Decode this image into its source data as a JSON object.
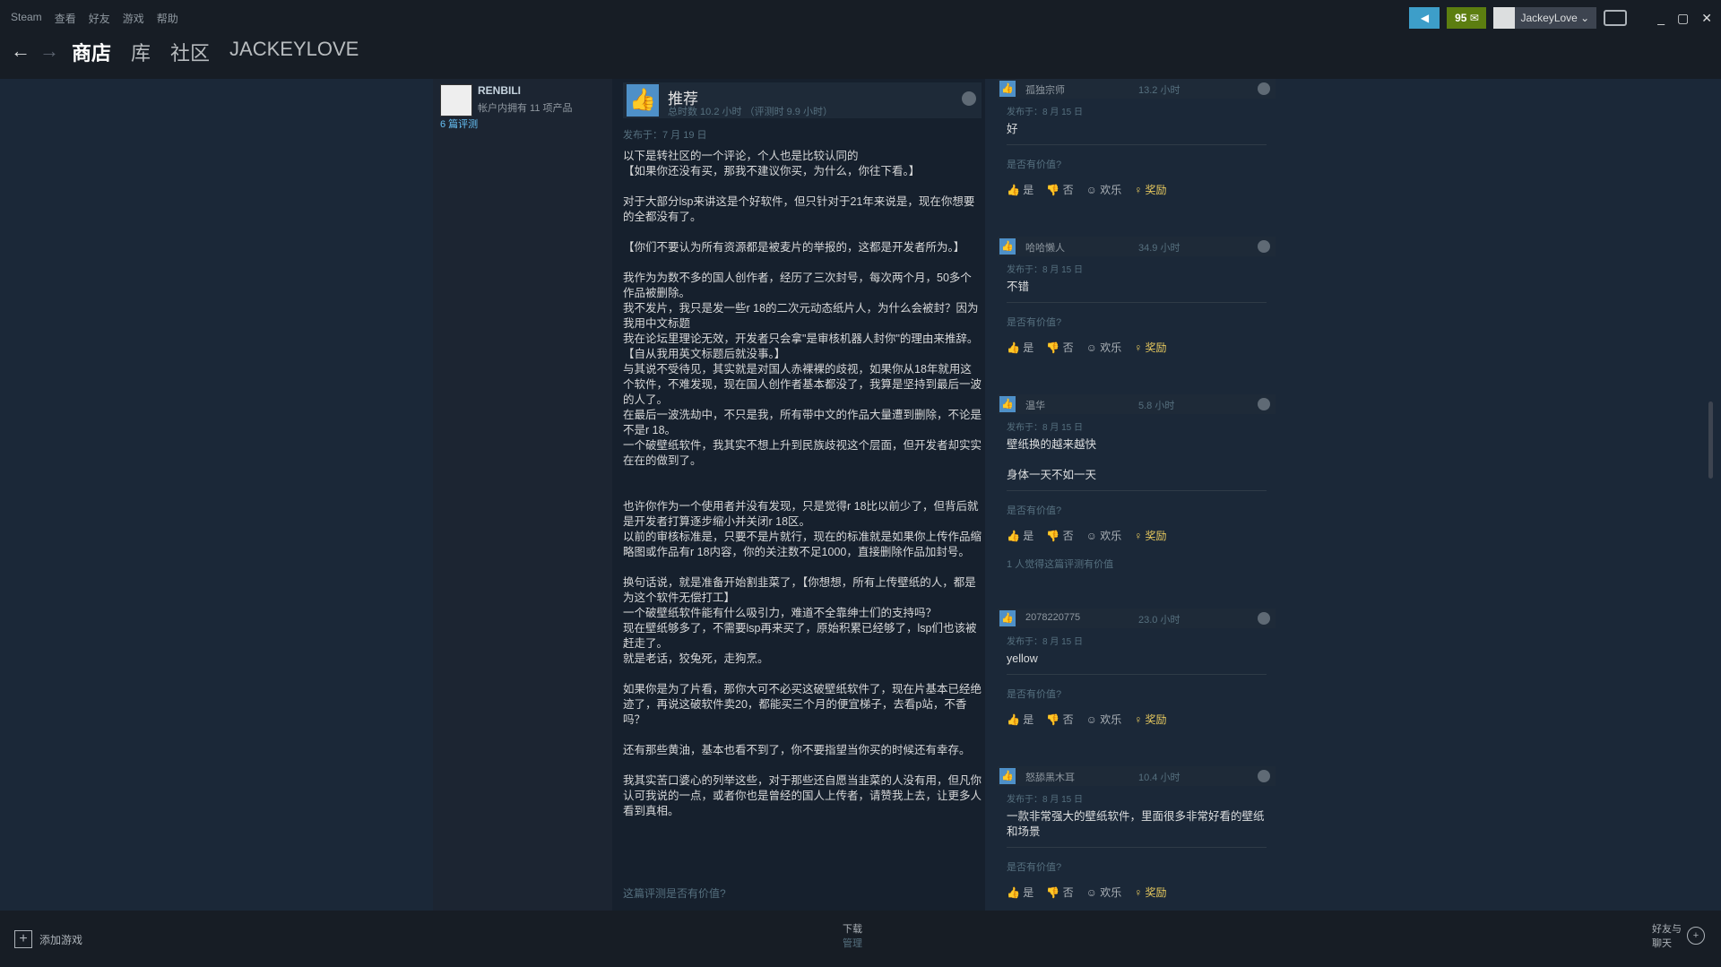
{
  "menu": [
    "Steam",
    "查看",
    "好友",
    "游戏",
    "帮助"
  ],
  "nav": {
    "store": "商店",
    "library": "库",
    "community": "社区",
    "username": "JACKEYLOVE"
  },
  "topright": {
    "notifications": "95 ✉",
    "account": "JackeyLove ⌄",
    "announce_icon": "◀"
  },
  "window_controls": [
    "_",
    "▢",
    "✕"
  ],
  "author": {
    "name": "RENBILI",
    "owned": "帐户内拥有 11 项产品",
    "reviews": "6 篇评测"
  },
  "review": {
    "verdict": "推荐",
    "hours": "总时数 10.2 小时 （评测时 9.9 小时）",
    "posted": "发布于：7 月 19 日",
    "body": "以下是转社区的一个评论，个人也是比较认同的\n【如果你还没有买，那我不建议你买，为什么，你往下看。】\n\n对于大部分lsp来讲这是个好软件，但只针对于21年来说是，现在你想要的全都没有了。\n\n【你们不要认为所有资源都是被麦片的举报的，这都是开发者所为。】\n\n我作为为数不多的国人创作者，经历了三次封号，每次两个月，50多个作品被删除。\n我不发片，我只是发一些r 18的二次元动态纸片人，为什么会被封？因为我用中文标题\n我在论坛里理论无效，开发者只会拿\"是审核机器人封你\"的理由来推辞。【自从我用英文标题后就没事。】\n与其说不受待见，其实就是对国人赤裸裸的歧视，如果你从18年就用这个软件，不难发现，现在国人创作者基本都没了，我算是坚持到最后一波的人了。\n在最后一波洗劫中，不只是我，所有带中文的作品大量遭到删除，不论是不是r 18。\n一个破壁纸软件，我其实不想上升到民族歧视这个层面，但开发者却实实在在的做到了。\n\n\n也许你作为一个使用者并没有发现，只是觉得r 18比以前少了，但背后就是开发者打算逐步缩小并关闭r 18区。\n以前的审核标准是，只要不是片就行，现在的标准就是如果你上传作品缩略图或作品有r 18内容，你的关注数不足1000，直接删除作品加封号。\n\n换句话说，就是准备开始割韭菜了，【你想想，所有上传壁纸的人，都是为这个软件无偿打工】\n一个破壁纸软件能有什么吸引力，难道不全靠绅士们的支持吗？\n现在壁纸够多了，不需要lsp再来买了，原始积累已经够了，lsp们也该被赶走了。\n就是老话，狡兔死，走狗烹。\n\n如果你是为了片看，那你大可不必买这破壁纸软件了，现在片基本已经绝迹了，再说这破软件卖20，都能买三个月的便宜梯子，去看p站，不香吗？\n\n还有那些黄油，基本也看不到了，你不要指望当你买的时候还有幸存。\n\n我其实苦口婆心的列举这些，对于那些还自愿当韭菜的人没有用，但凡你认可我说的一点，或者你也是曾经的国人上传者，请赞我上去，让更多人看到真相。",
    "helpful_question": "这篇评测是否有价值?"
  },
  "vote_labels": {
    "yes": "是",
    "no": "否",
    "funny": "欢乐",
    "award": "奖励",
    "question": "是否有价值?"
  },
  "comments": [
    {
      "name": "孤独宗师",
      "hours": "13.2 小时",
      "date": "发布于：8 月 15 日",
      "text": "好",
      "found": ""
    },
    {
      "name": "哈哈懒人",
      "hours": "34.9 小时",
      "date": "发布于：8 月 15 日",
      "text": "不错",
      "found": ""
    },
    {
      "name": "温华",
      "hours": "5.8 小时",
      "date": "发布于：8 月 15 日",
      "text": "壁纸换的越来越快\n\n身体一天不如一天",
      "found": "1 人觉得这篇评测有价值"
    },
    {
      "name": "2078220775",
      "hours": "23.0 小时",
      "date": "发布于：8 月 15 日",
      "text": "yellow",
      "found": ""
    },
    {
      "name": "怒舔黑木耳",
      "hours": "10.4 小时",
      "date": "发布于：8 月 15 日",
      "text": "一款非常强大的壁纸软件，里面很多非常好看的壁纸和场景",
      "found": ""
    }
  ],
  "bottom": {
    "add_game": "添加游戏",
    "downloads": "下载",
    "downloads_sub": "管理",
    "friends": "好友与\n聊天"
  }
}
